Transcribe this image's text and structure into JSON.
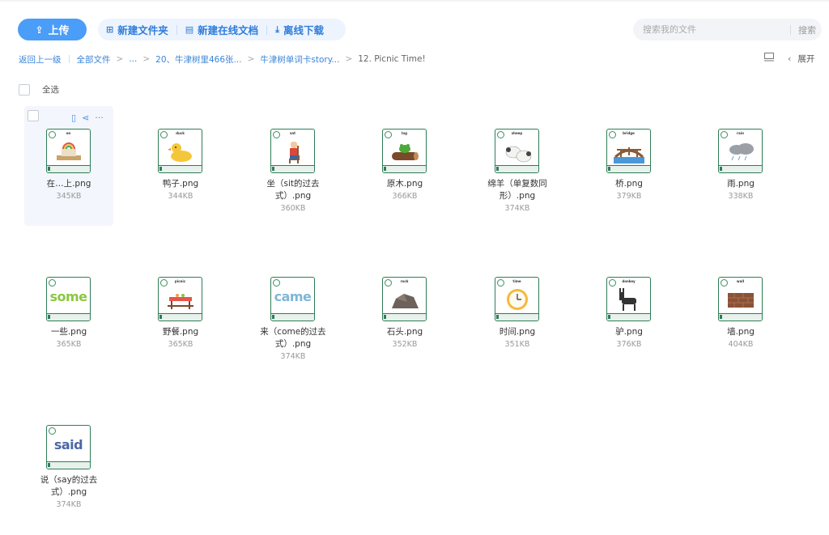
{
  "toolbar": {
    "upload_label": "上传",
    "new_folder_label": "新建文件夹",
    "new_doc_label": "新建在线文档",
    "offline_download_label": "离线下载"
  },
  "search": {
    "placeholder": "搜索我的文件",
    "button_label": "搜索"
  },
  "breadcrumb": {
    "back_label": "返回上一级",
    "items": [
      "全部文件",
      "...",
      "20、牛津树里466张...",
      "牛津树单词卡story...",
      "12. Picnic Time!"
    ]
  },
  "view": {
    "expand_label": "展开"
  },
  "select_all_label": "全选",
  "accent_color": "#4a9df8",
  "files": [
    {
      "card_word": "on",
      "name": "在…上.png",
      "size": "345KB",
      "icon": "boat-icon"
    },
    {
      "card_word": "duck",
      "name": "鸭子.png",
      "size": "344KB",
      "icon": "duck-icon"
    },
    {
      "card_word": "sat",
      "name": "坐（sit的过去式）.png",
      "size": "360KB",
      "icon": "boy-sitting-icon"
    },
    {
      "card_word": "log",
      "name": "原木.png",
      "size": "366KB",
      "icon": "log-frog-icon"
    },
    {
      "card_word": "sheep",
      "name": "绵羊（单复数同形）.png",
      "size": "374KB",
      "icon": "sheep-icon"
    },
    {
      "card_word": "bridge",
      "name": "桥.png",
      "size": "379KB",
      "icon": "bridge-icon"
    },
    {
      "card_word": "rain",
      "name": "雨.png",
      "size": "338KB",
      "icon": "rain-cloud-icon"
    },
    {
      "card_word": "some",
      "name": "一些.png",
      "size": "365KB",
      "icon": "word-some"
    },
    {
      "card_word": "picnic",
      "name": "野餐.png",
      "size": "365KB",
      "icon": "picnic-table-icon"
    },
    {
      "card_word": "came",
      "name": "来（come的过去式）.png",
      "size": "374KB",
      "icon": "word-came"
    },
    {
      "card_word": "rock",
      "name": "石头.png",
      "size": "352KB",
      "icon": "rock-icon"
    },
    {
      "card_word": "time",
      "name": "时间.png",
      "size": "351KB",
      "icon": "clock-icon"
    },
    {
      "card_word": "donkey",
      "name": "驴.png",
      "size": "376KB",
      "icon": "donkey-icon"
    },
    {
      "card_word": "wall",
      "name": "墙.png",
      "size": "404KB",
      "icon": "brick-wall-icon"
    },
    {
      "card_word": "said",
      "name": "说（say的过去式）.png",
      "size": "374KB",
      "icon": "word-said"
    }
  ]
}
